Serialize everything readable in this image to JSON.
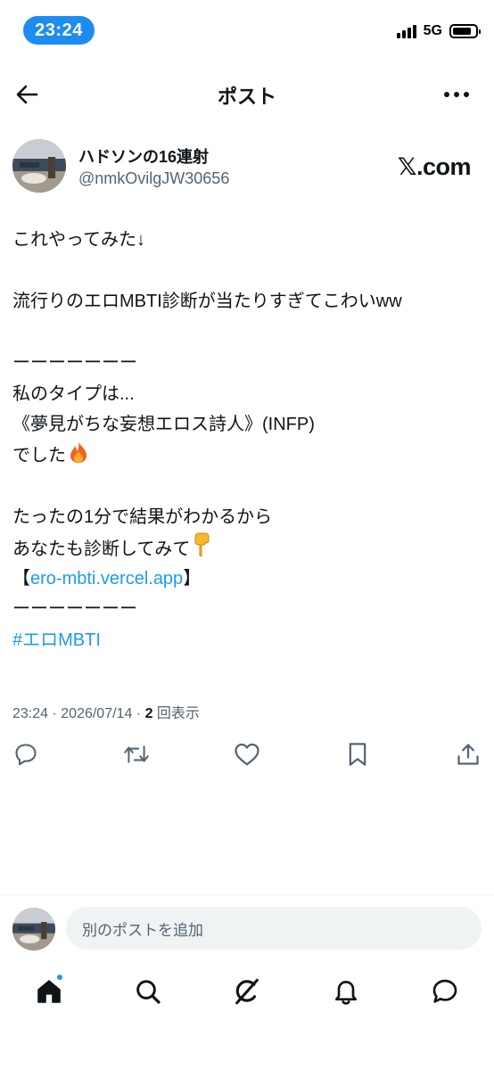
{
  "status_bar": {
    "time": "23:24",
    "network": "5G"
  },
  "header": {
    "title": "ポスト"
  },
  "author": {
    "name": "ハドソンの16連射",
    "handle": "@nmkOvilgJW30656"
  },
  "brand": {
    "label": "𝕏.com"
  },
  "post": {
    "line1": "これやってみた↓",
    "line2": "流行りのエロMBTI診断が当たりすぎてこわいww",
    "line3": "ーーーーーーー",
    "line4": "私のタイプは...",
    "line5": "《夢見がちな妄想エロス詩人》(INFP)",
    "line6": "でした",
    "line7": "たったの1分で結果がわかるから",
    "line8": "あなたも診断してみて",
    "link_open": "【",
    "link_text": "ero-mbti.vercel.app",
    "link_close": "】",
    "line10": "ーーーーーーー",
    "hashtag": "#エロMBTI"
  },
  "meta": {
    "time": "23:24",
    "separator": " · ",
    "date": "2026/07/14",
    "views_count": "2",
    "views_label": " 回表示"
  },
  "compose": {
    "placeholder": "別のポストを追加"
  },
  "icons": {
    "back": "arrow-left-icon",
    "more": "more-horizontal-icon",
    "reply": "reply-icon",
    "repost": "repost-icon",
    "like": "heart-icon",
    "bookmark": "bookmark-icon",
    "share": "share-icon",
    "home": "home-icon",
    "search": "search-icon",
    "grok": "grok-icon",
    "notifications": "bell-icon",
    "messages": "messages-icon"
  },
  "colors": {
    "accent": "#1d9bf0",
    "time_pill": "#1d8cf0",
    "text": "#0f1419",
    "muted": "#536471"
  }
}
